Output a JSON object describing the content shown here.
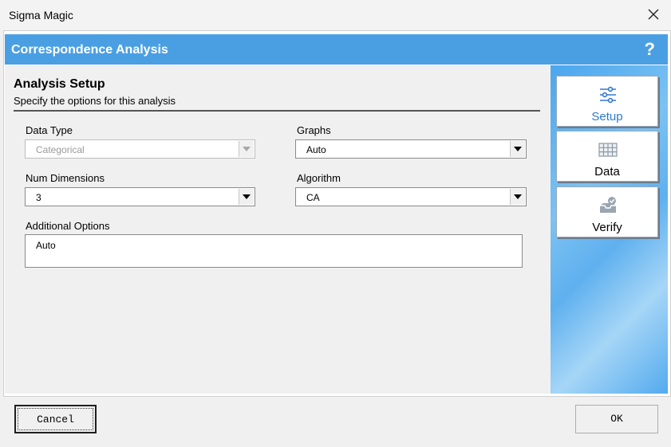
{
  "window": {
    "title": "Sigma Magic"
  },
  "banner": {
    "title": "Correspondence Analysis",
    "help": "?"
  },
  "section": {
    "title": "Analysis Setup",
    "subtitle": "Specify the options for this analysis"
  },
  "fields": {
    "data_type": {
      "label": "Data Type",
      "value": "Categorical",
      "disabled": true
    },
    "graphs": {
      "label": "Graphs",
      "value": "Auto"
    },
    "num_dimensions": {
      "label": "Num Dimensions",
      "value": "3"
    },
    "algorithm": {
      "label": "Algorithm",
      "value": "CA"
    },
    "additional_options": {
      "label": "Additional Options",
      "value": "Auto"
    }
  },
  "nav": [
    {
      "label": "Setup",
      "icon": "sliders-icon",
      "active": true
    },
    {
      "label": "Data",
      "icon": "table-icon",
      "active": false
    },
    {
      "label": "Verify",
      "icon": "inbox-check-icon",
      "active": false
    }
  ],
  "buttons": {
    "cancel": "Cancel",
    "ok": "OK"
  },
  "colors": {
    "banner": "#4a9fe3",
    "active_nav": "#2f78d0"
  }
}
